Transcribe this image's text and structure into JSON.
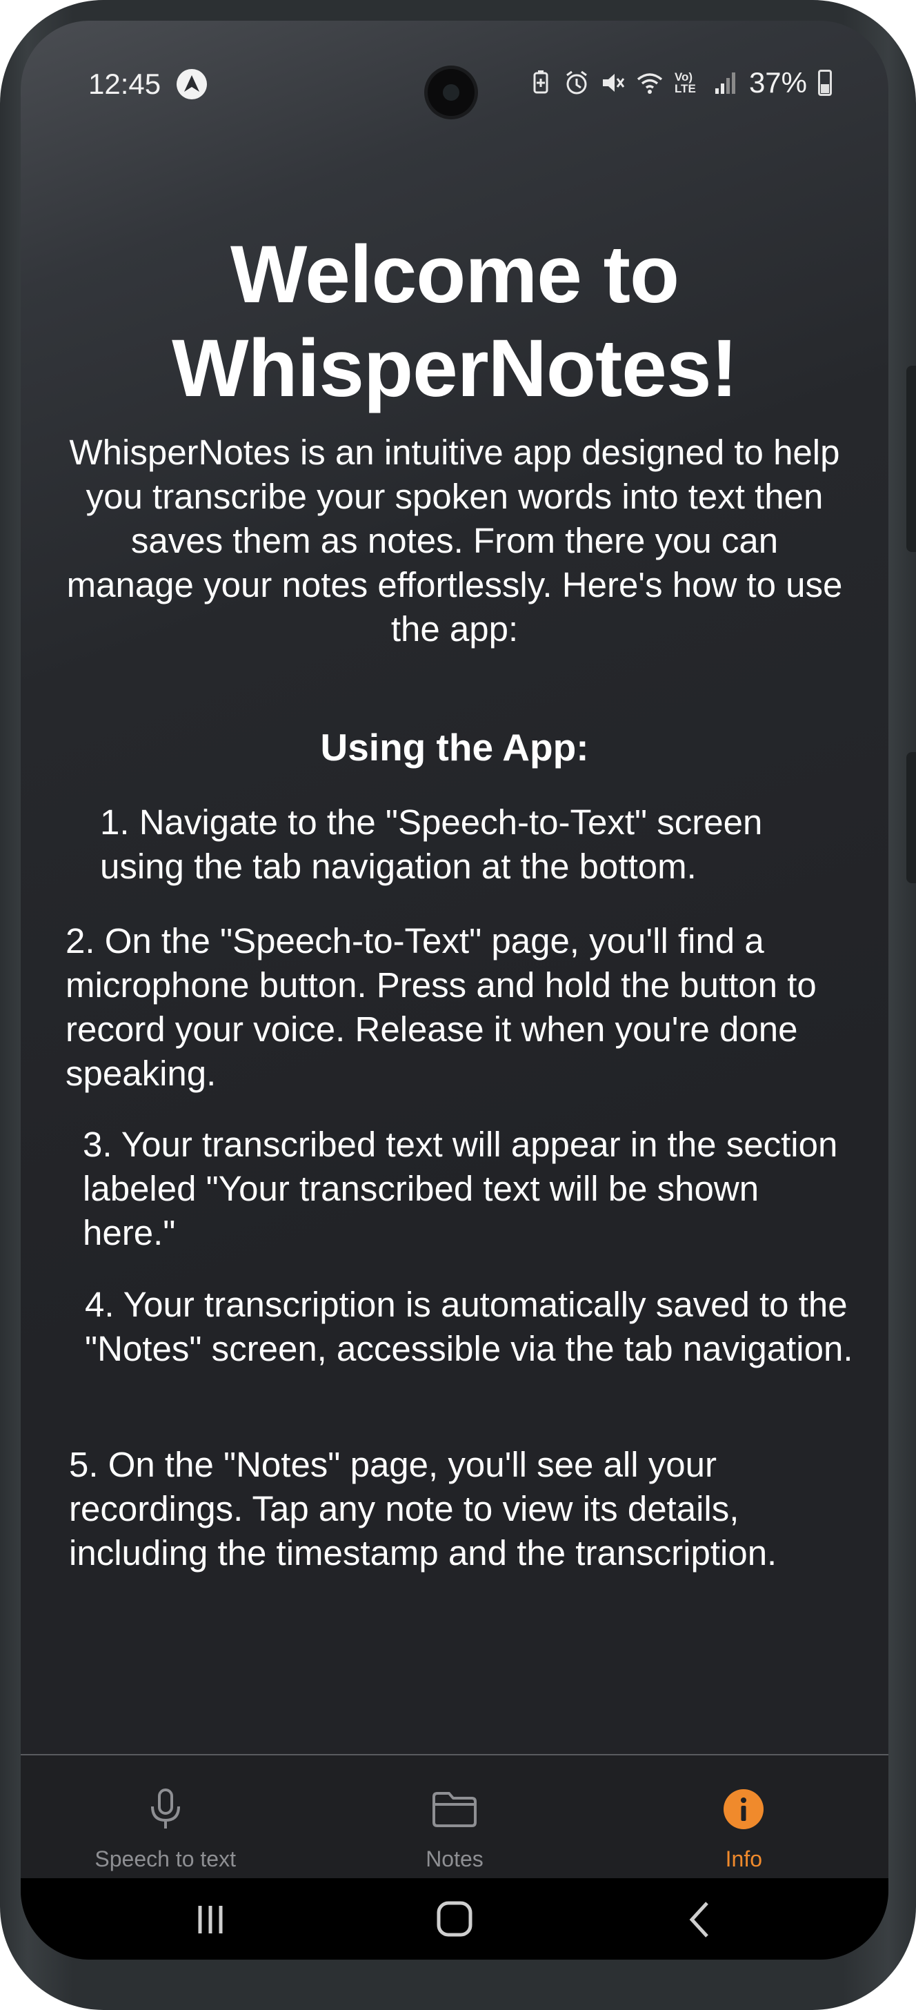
{
  "status_bar": {
    "time": "12:45",
    "battery_percent": "37%",
    "icons": [
      "navigation-icon",
      "battery-saver-icon",
      "alarm-icon",
      "mute-icon",
      "wifi-icon",
      "volte-icon",
      "signal-icon",
      "battery-icon"
    ],
    "volte_label": "Vo) LTE"
  },
  "content": {
    "title": "Welcome to WhisperNotes!",
    "intro": "WhisperNotes is an intuitive app designed to help you transcribe your spoken words into text then saves them as notes. From there you can manage your notes effortlessly. Here's how to use the app:",
    "section_heading": "Using the App:",
    "steps": [
      "1. Navigate to the \"Speech-to-Text\" screen using the tab navigation at the bottom.",
      "2. On the \"Speech-to-Text\" page, you'll find a microphone button. Press and hold the button to record your voice. Release it when you're done speaking.",
      "3. Your transcribed text will appear in the section labeled \"Your transcribed text will be shown here.\"",
      "4. Your transcription is automatically saved to the \"Notes\" screen, accessible via the tab navigation.",
      "5. On the \"Notes\" page, you'll see all your recordings. Tap any note to view its details, including the timestamp and the transcription."
    ]
  },
  "tab_bar": {
    "tabs": [
      {
        "label": "Speech to text",
        "icon": "microphone-icon",
        "active": false
      },
      {
        "label": "Notes",
        "icon": "folder-icon",
        "active": false
      },
      {
        "label": "Info",
        "icon": "info-icon",
        "active": true
      }
    ]
  },
  "colors": {
    "background": "#222327",
    "text": "#ffffff",
    "tab_inactive": "#8e8f93",
    "tab_active": "#f08a2c",
    "tab_bar_bg": "#1f2023"
  },
  "system_nav": {
    "buttons": [
      "recent-apps-icon",
      "home-icon",
      "back-icon"
    ]
  }
}
